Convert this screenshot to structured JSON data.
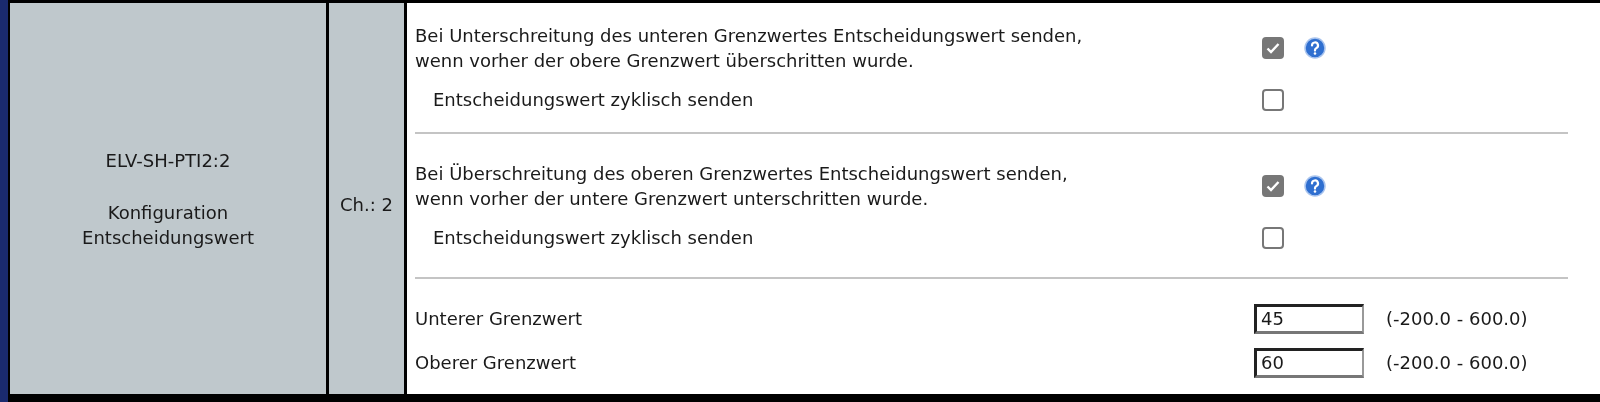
{
  "device": {
    "name": "ELV-SH-PTI2:2",
    "description_lines": [
      "Konfiguration",
      "Entscheidungswert"
    ]
  },
  "channel": "Ch.: 2",
  "sections": [
    {
      "kind": "checks",
      "rows": [
        {
          "label_lines": [
            "Bei Unterschreitung des unteren Grenzwertes Entscheidungswert senden,",
            "wenn vorher der obere Grenzwert überschritten wurde."
          ],
          "checked": true,
          "help": true,
          "indented": false
        },
        {
          "label_lines": [
            "Entscheidungswert zyklisch senden"
          ],
          "checked": false,
          "help": false,
          "indented": true
        }
      ]
    },
    {
      "kind": "checks",
      "rows": [
        {
          "label_lines": [
            "Bei Überschreitung des oberen Grenzwertes Entscheidungswert senden,",
            "wenn vorher der untere Grenzwert unterschritten wurde."
          ],
          "checked": true,
          "help": true,
          "indented": false
        },
        {
          "label_lines": [
            "Entscheidungswert zyklisch senden"
          ],
          "checked": false,
          "help": false,
          "indented": true
        }
      ]
    },
    {
      "kind": "values",
      "rows": [
        {
          "label": "Unterer Grenzwert",
          "value": "45",
          "range": "(-200.0 - 600.0)"
        },
        {
          "label": "Oberer Grenzwert",
          "value": "60",
          "range": "(-200.0 - 600.0)"
        }
      ]
    }
  ]
}
